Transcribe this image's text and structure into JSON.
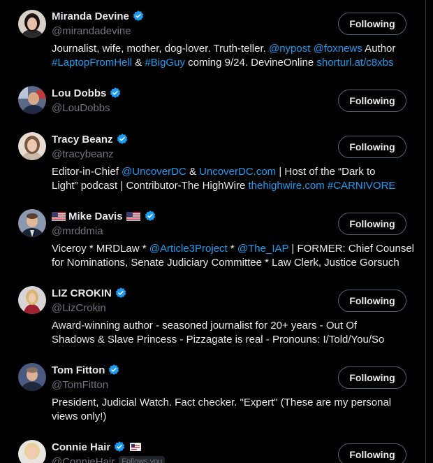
{
  "accent": "#1d9bf0",
  "follow_button_label": "Following",
  "users": [
    {
      "name": "Miranda Devine",
      "handle": "@mirandadevine",
      "bio_line1": [
        {
          "t": "Journalist, wife, mother, dog-lover. Truth-teller. ",
          "link": false
        },
        {
          "t": "@nypost",
          "link": true
        },
        {
          "t": " ",
          "link": false
        },
        {
          "t": "@foxnews",
          "link": true
        },
        {
          "t": " Author",
          "link": false
        }
      ],
      "bio_line2": [
        {
          "t": "#LaptopFromHell",
          "link": true
        },
        {
          "t": " & ",
          "link": false
        },
        {
          "t": "#BigGuy",
          "link": true
        },
        {
          "t": " coming 9/24. DevineOnline ",
          "link": false
        },
        {
          "t": "shorturl.at/c8xbs",
          "link": true
        }
      ]
    },
    {
      "name": "Lou Dobbs",
      "handle": "@LouDobbs"
    },
    {
      "name": "Tracy Beanz",
      "handle": "@tracybeanz",
      "bio_line1": [
        {
          "t": "Editor-in-Chief ",
          "link": false
        },
        {
          "t": "@UncoverDC",
          "link": true
        },
        {
          "t": " & ",
          "link": false
        },
        {
          "t": "UncoverDC.com",
          "link": true
        },
        {
          "t": " | Host of the “Dark to",
          "link": false
        }
      ],
      "bio_line2": [
        {
          "t": "Light” podcast | Contributor-The HighWire ",
          "link": false
        },
        {
          "t": "thehighwire.com",
          "link": true
        },
        {
          "t": " ",
          "link": false
        },
        {
          "t": "#CARNIVORE",
          "link": true
        }
      ]
    },
    {
      "name": "Mike Davis",
      "handle": "@mrddmia",
      "bio_line1": [
        {
          "t": "Viceroy * MRDLaw * ",
          "link": false
        },
        {
          "t": "@Article3Project",
          "link": true
        },
        {
          "t": " * ",
          "link": false
        },
        {
          "t": "@The_IAP",
          "link": true
        },
        {
          "t": " | FORMER: Chief Counsel",
          "link": false
        }
      ],
      "bio_line2": [
        {
          "t": "for Nominations, Senate Judiciary Committee * Law Clerk, Justice Gorsuch",
          "link": false
        }
      ]
    },
    {
      "name": "LIZ CROKIN",
      "handle": "@LizCrokin",
      "bio_line1": [
        {
          "t": "Award-winning author - seasoned journalist for 20+ years - Out Of",
          "link": false
        }
      ],
      "bio_line2": [
        {
          "t": "Shadows & Slave Princess - Pizzagate is real - Pronouns: I/Told/You/So",
          "link": false
        }
      ]
    },
    {
      "name": "Tom Fitton",
      "handle": "@TomFitton",
      "bio_line1": [
        {
          "t": "President, Judicial Watch. Fact checker. \"Expert\" (These are my personal",
          "link": false
        }
      ],
      "bio_line2": [
        {
          "t": "views only!)",
          "link": false
        }
      ]
    },
    {
      "name": "Connie Hair",
      "handle": "@ConnieHair",
      "follows_you": "Follows you"
    }
  ]
}
